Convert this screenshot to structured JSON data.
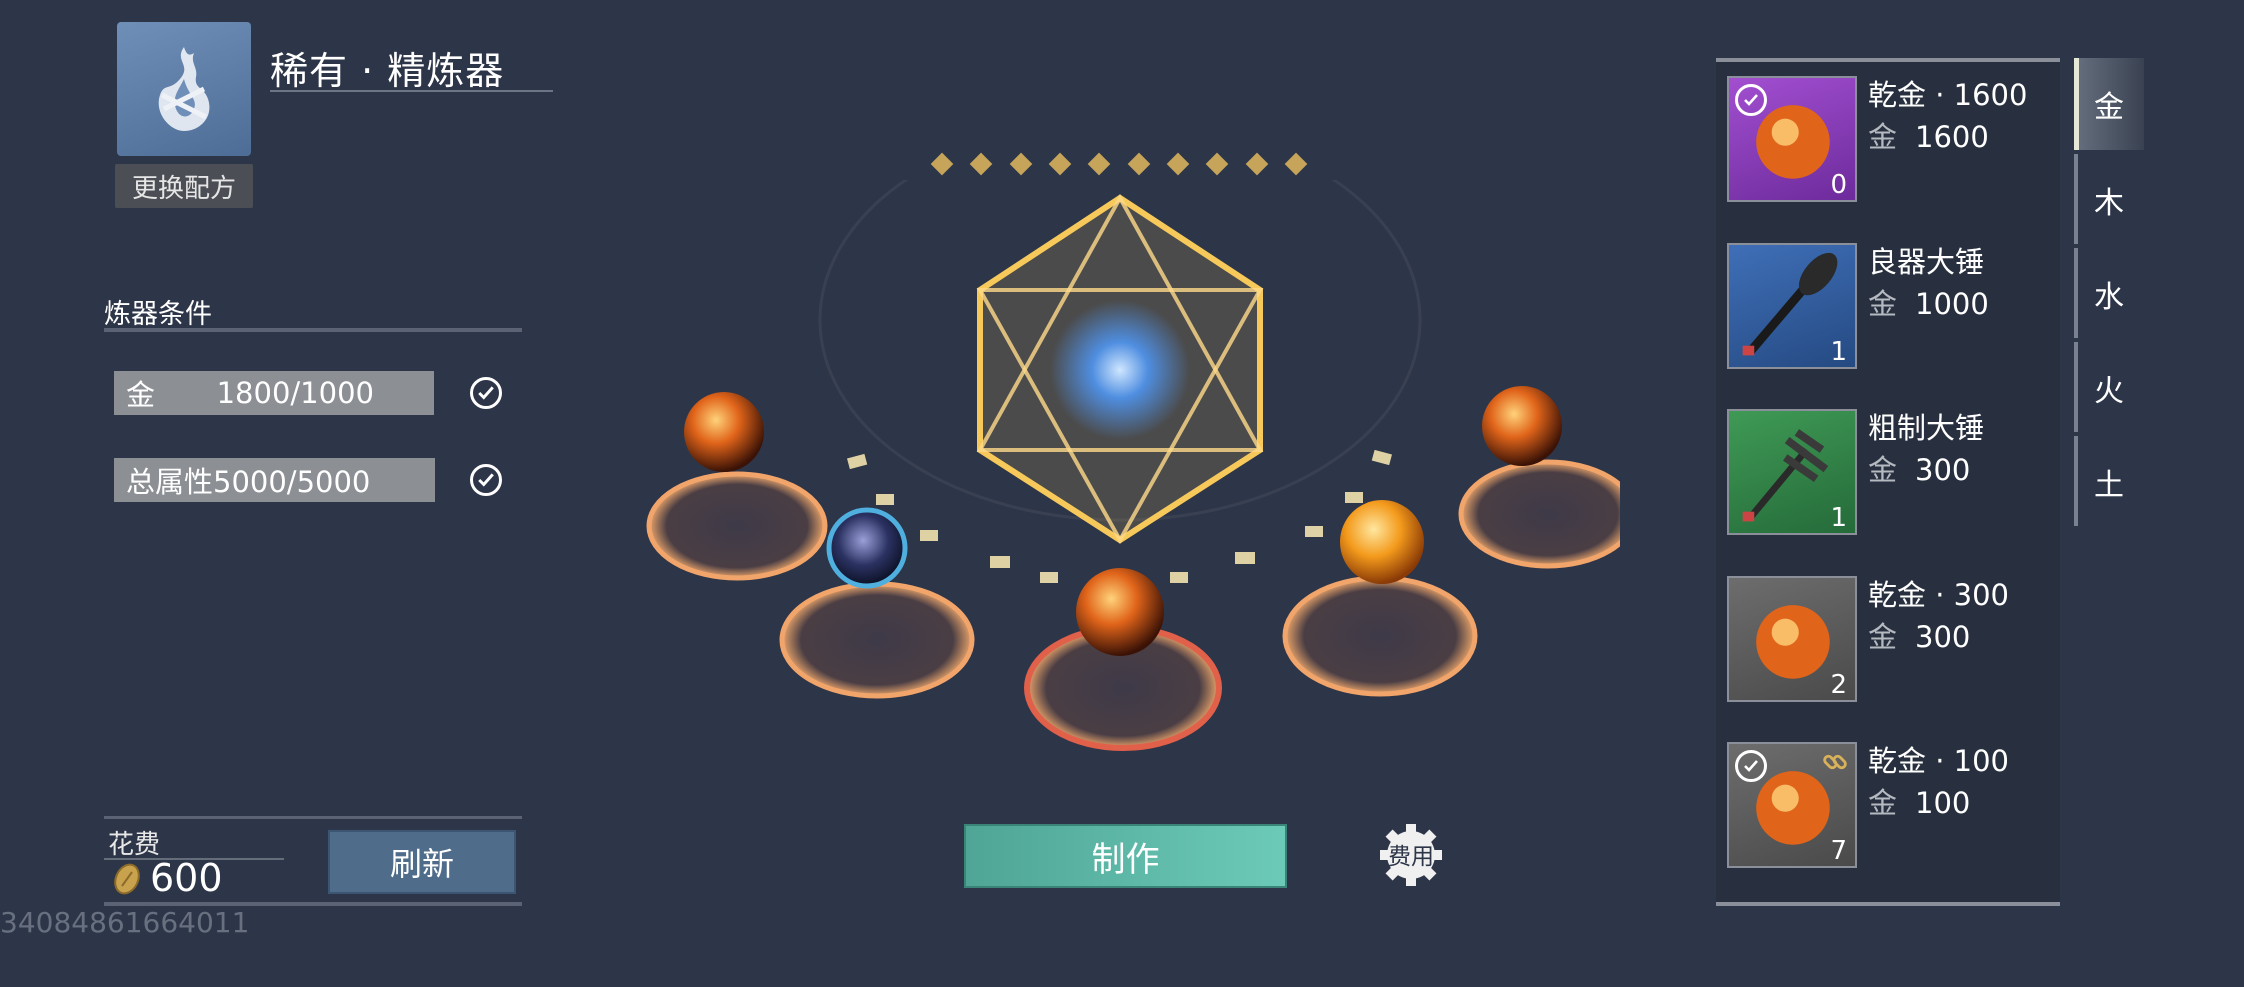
{
  "header": {
    "title": "稀有 · 精炼器",
    "change_recipe": "更换配方",
    "recipe_icon": "flame-glyph-icon"
  },
  "conditions": {
    "title": "炼器条件",
    "rows": [
      {
        "key": "金",
        "value": "1800/1000",
        "met": true
      },
      {
        "key": "总属性5000/5000",
        "value": "",
        "met": true
      }
    ]
  },
  "cost": {
    "label": "花费",
    "value": "600",
    "refresh": "刷新"
  },
  "uid": "34084861664011",
  "center": {
    "make_button": "制作",
    "fee_button": "费用",
    "diamond_count": 10
  },
  "materials": [
    {
      "name": "乾金 · 1600",
      "element": "金",
      "amount": "1600",
      "count": "0",
      "thumb": "orb-purple",
      "selected": true,
      "linked": false
    },
    {
      "name": "良器大锤",
      "element": "金",
      "amount": "1000",
      "count": "1",
      "thumb": "hammer-blue",
      "selected": false,
      "linked": false
    },
    {
      "name": "粗制大锤",
      "element": "金",
      "amount": "300",
      "count": "1",
      "thumb": "hammer-green",
      "selected": false,
      "linked": false
    },
    {
      "name": "乾金 · 300",
      "element": "金",
      "amount": "300",
      "count": "2",
      "thumb": "orb-gray",
      "selected": false,
      "linked": false
    },
    {
      "name": "乾金 · 100",
      "element": "金",
      "amount": "100",
      "count": "7",
      "thumb": "orb-gray",
      "selected": true,
      "linked": true
    }
  ],
  "element_tabs": [
    "金",
    "木",
    "水",
    "火",
    "土"
  ],
  "colors": {
    "background": "#2d3548",
    "accent_gold": "#c6a55a",
    "make_button": "#5bb5a5",
    "refresh_button": "#4f6d8b"
  }
}
